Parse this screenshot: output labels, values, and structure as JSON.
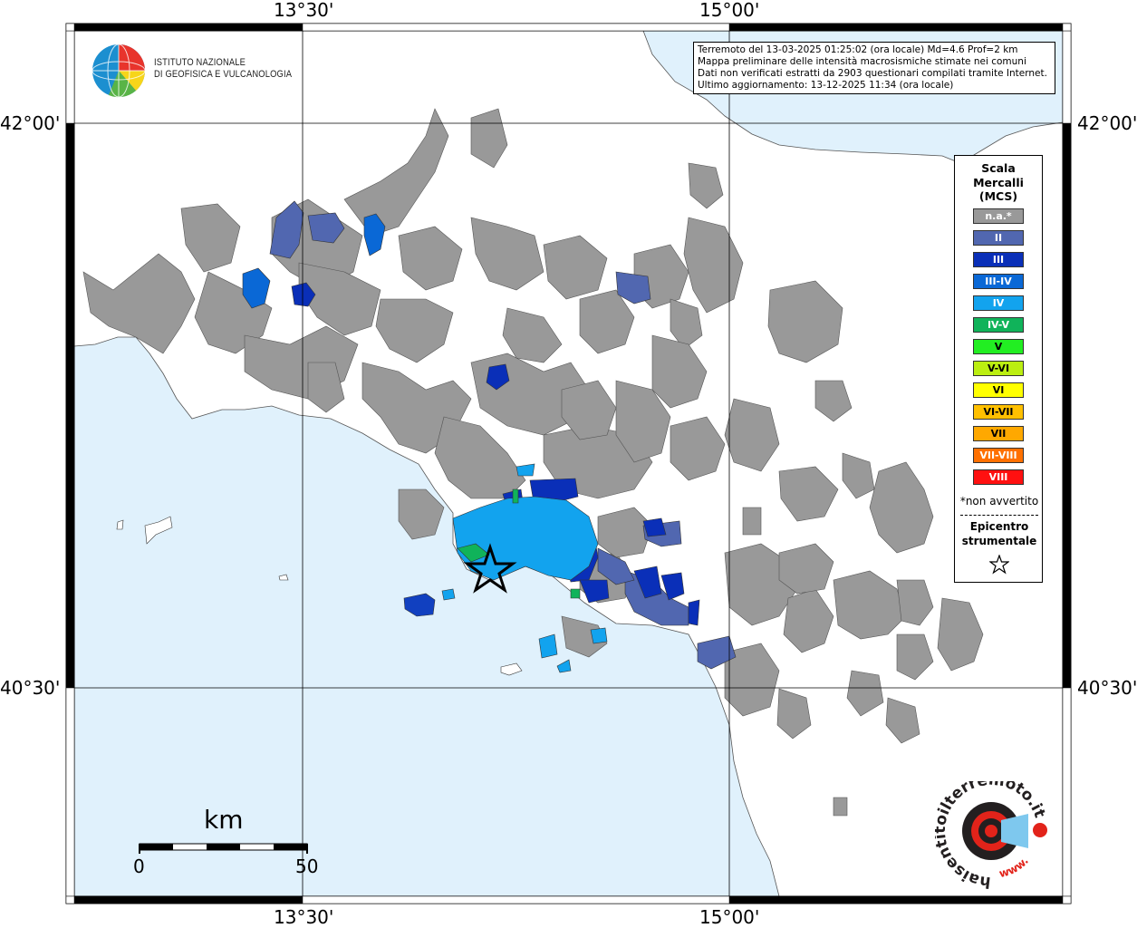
{
  "map": {
    "coordinates": {
      "top_left_label": "13°30'",
      "top_right_label": "15°00'",
      "bottom_left_label": "13°30'",
      "bottom_right_label": "15°00'",
      "left_top_label": "42°00'",
      "left_bottom_label": "40°30'",
      "right_top_label": "42°00'",
      "right_bottom_label": "40°30'"
    },
    "colors": {
      "sea": "#e0f1fc",
      "land": "#ffffff",
      "not_felt": "#999999"
    }
  },
  "institute": {
    "line1": "ISTITUTO NAZIONALE",
    "line2": "DI GEOFISICA E VULCANOLOGIA",
    "logo_icon": "globe-icon"
  },
  "info": {
    "line1": "Terremoto del 13-03-2025 01:25:02 (ora locale) Md=4.6 Prof=2 km",
    "line2": "Mappa preliminare delle intensità macrosismiche stimate nei comuni",
    "line3": "Dati non verificati estratti da 2903 questionari compilati tramite Internet.",
    "line4": "Ultimo aggiornamento: 13-12-2025 11:34 (ora locale)"
  },
  "legend": {
    "title1": "Scala",
    "title2": "Mercalli",
    "title3": "(MCS)",
    "items": [
      {
        "label": "n.a.*",
        "color": "#999999"
      },
      {
        "label": "II",
        "color": "#5167b0"
      },
      {
        "label": "III",
        "color": "#0a2fb8"
      },
      {
        "label": "III-IV",
        "color": "#0a68d6"
      },
      {
        "label": "IV",
        "color": "#12a3ee"
      },
      {
        "label": "IV-V",
        "color": "#10b35a"
      },
      {
        "label": "V",
        "color": "#22ee22"
      },
      {
        "label": "V-VI",
        "color": "#bbee11"
      },
      {
        "label": "VI",
        "color": "#ffff00"
      },
      {
        "label": "VI-VII",
        "color": "#ffc000"
      },
      {
        "label": "VII",
        "color": "#ffa800"
      },
      {
        "label": "VII-VIII",
        "color": "#ff7000"
      },
      {
        "label": "VIII",
        "color": "#ff1010"
      }
    ],
    "not_felt_note": "*non avvertito",
    "epicenter_line1": "Epicentro",
    "epicenter_line2": "strumentale",
    "epicenter_icon": "star-icon"
  },
  "scale_bar": {
    "unit": "km",
    "start": "0",
    "end": "50"
  },
  "brand": {
    "text": "haisentitoilterremoto.it",
    "url_text": "www.",
    "icon": "speaker-target-icon"
  }
}
